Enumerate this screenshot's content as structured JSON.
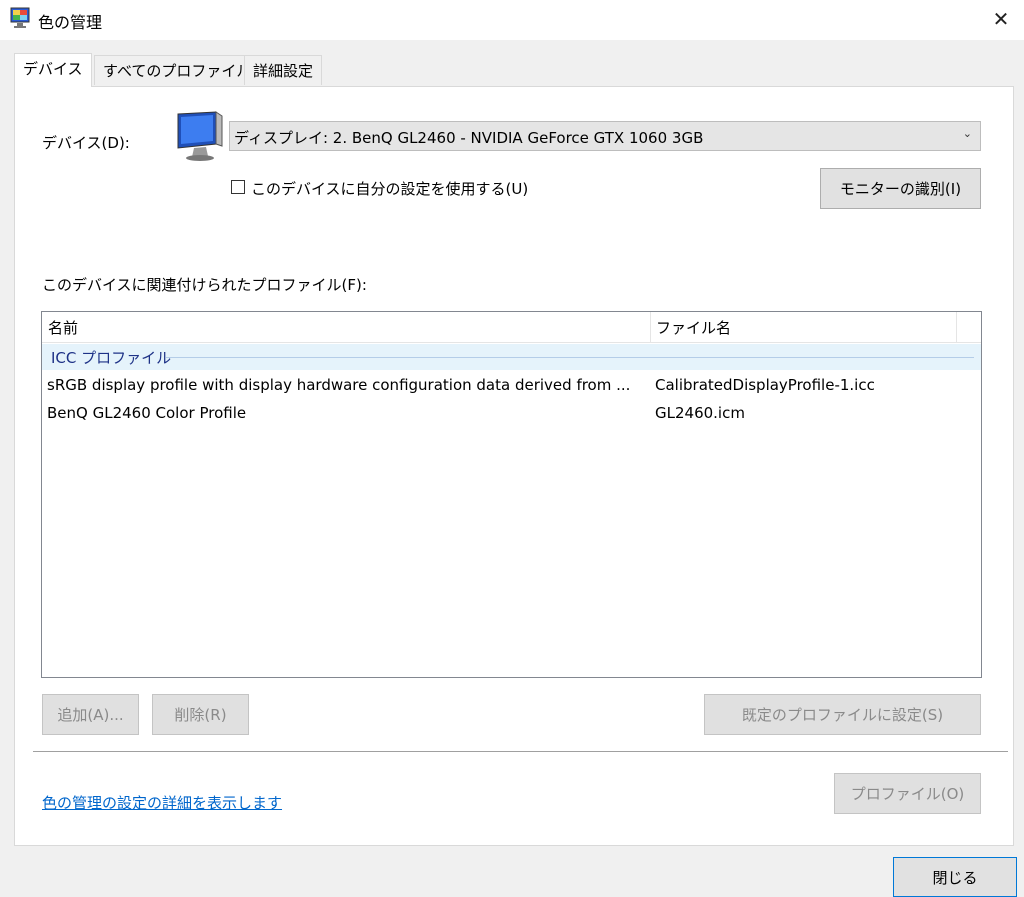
{
  "window": {
    "title": "色の管理",
    "close_glyph": "✕"
  },
  "tabs": [
    "デバイス",
    "すべてのプロファイル",
    "詳細設定"
  ],
  "device": {
    "label": "デバイス(D):",
    "selected": "ディスプレイ: 2. BenQ GL2460 - NVIDIA GeForce GTX 1060 3GB",
    "chevron": "⌄",
    "use_my_settings_label": "このデバイスに自分の設定を使用する(U)",
    "use_my_settings_checked": false,
    "identify_button": "モニターの識別(I)"
  },
  "profiles": {
    "label": "このデバイスに関連付けられたプロファイル(F):",
    "columns": [
      "名前",
      "ファイル名"
    ],
    "group": "ICC プロファイル",
    "rows": [
      {
        "name": "sRGB display profile with display hardware configuration data derived from ...",
        "file": "CalibratedDisplayProfile-1.icc"
      },
      {
        "name": "BenQ GL2460 Color Profile",
        "file": "GL2460.icm"
      }
    ]
  },
  "buttons": {
    "add": "追加(A)...",
    "remove": "削除(R)",
    "set_default": "既定のプロファイルに設定(S)",
    "profile": "プロファイル(O)",
    "close": "閉じる"
  },
  "link": "色の管理の設定の詳細を表示します",
  "colors": {
    "link": "#0066cc",
    "group_bg": "#e5f3fb",
    "group_text": "#1e3287"
  }
}
